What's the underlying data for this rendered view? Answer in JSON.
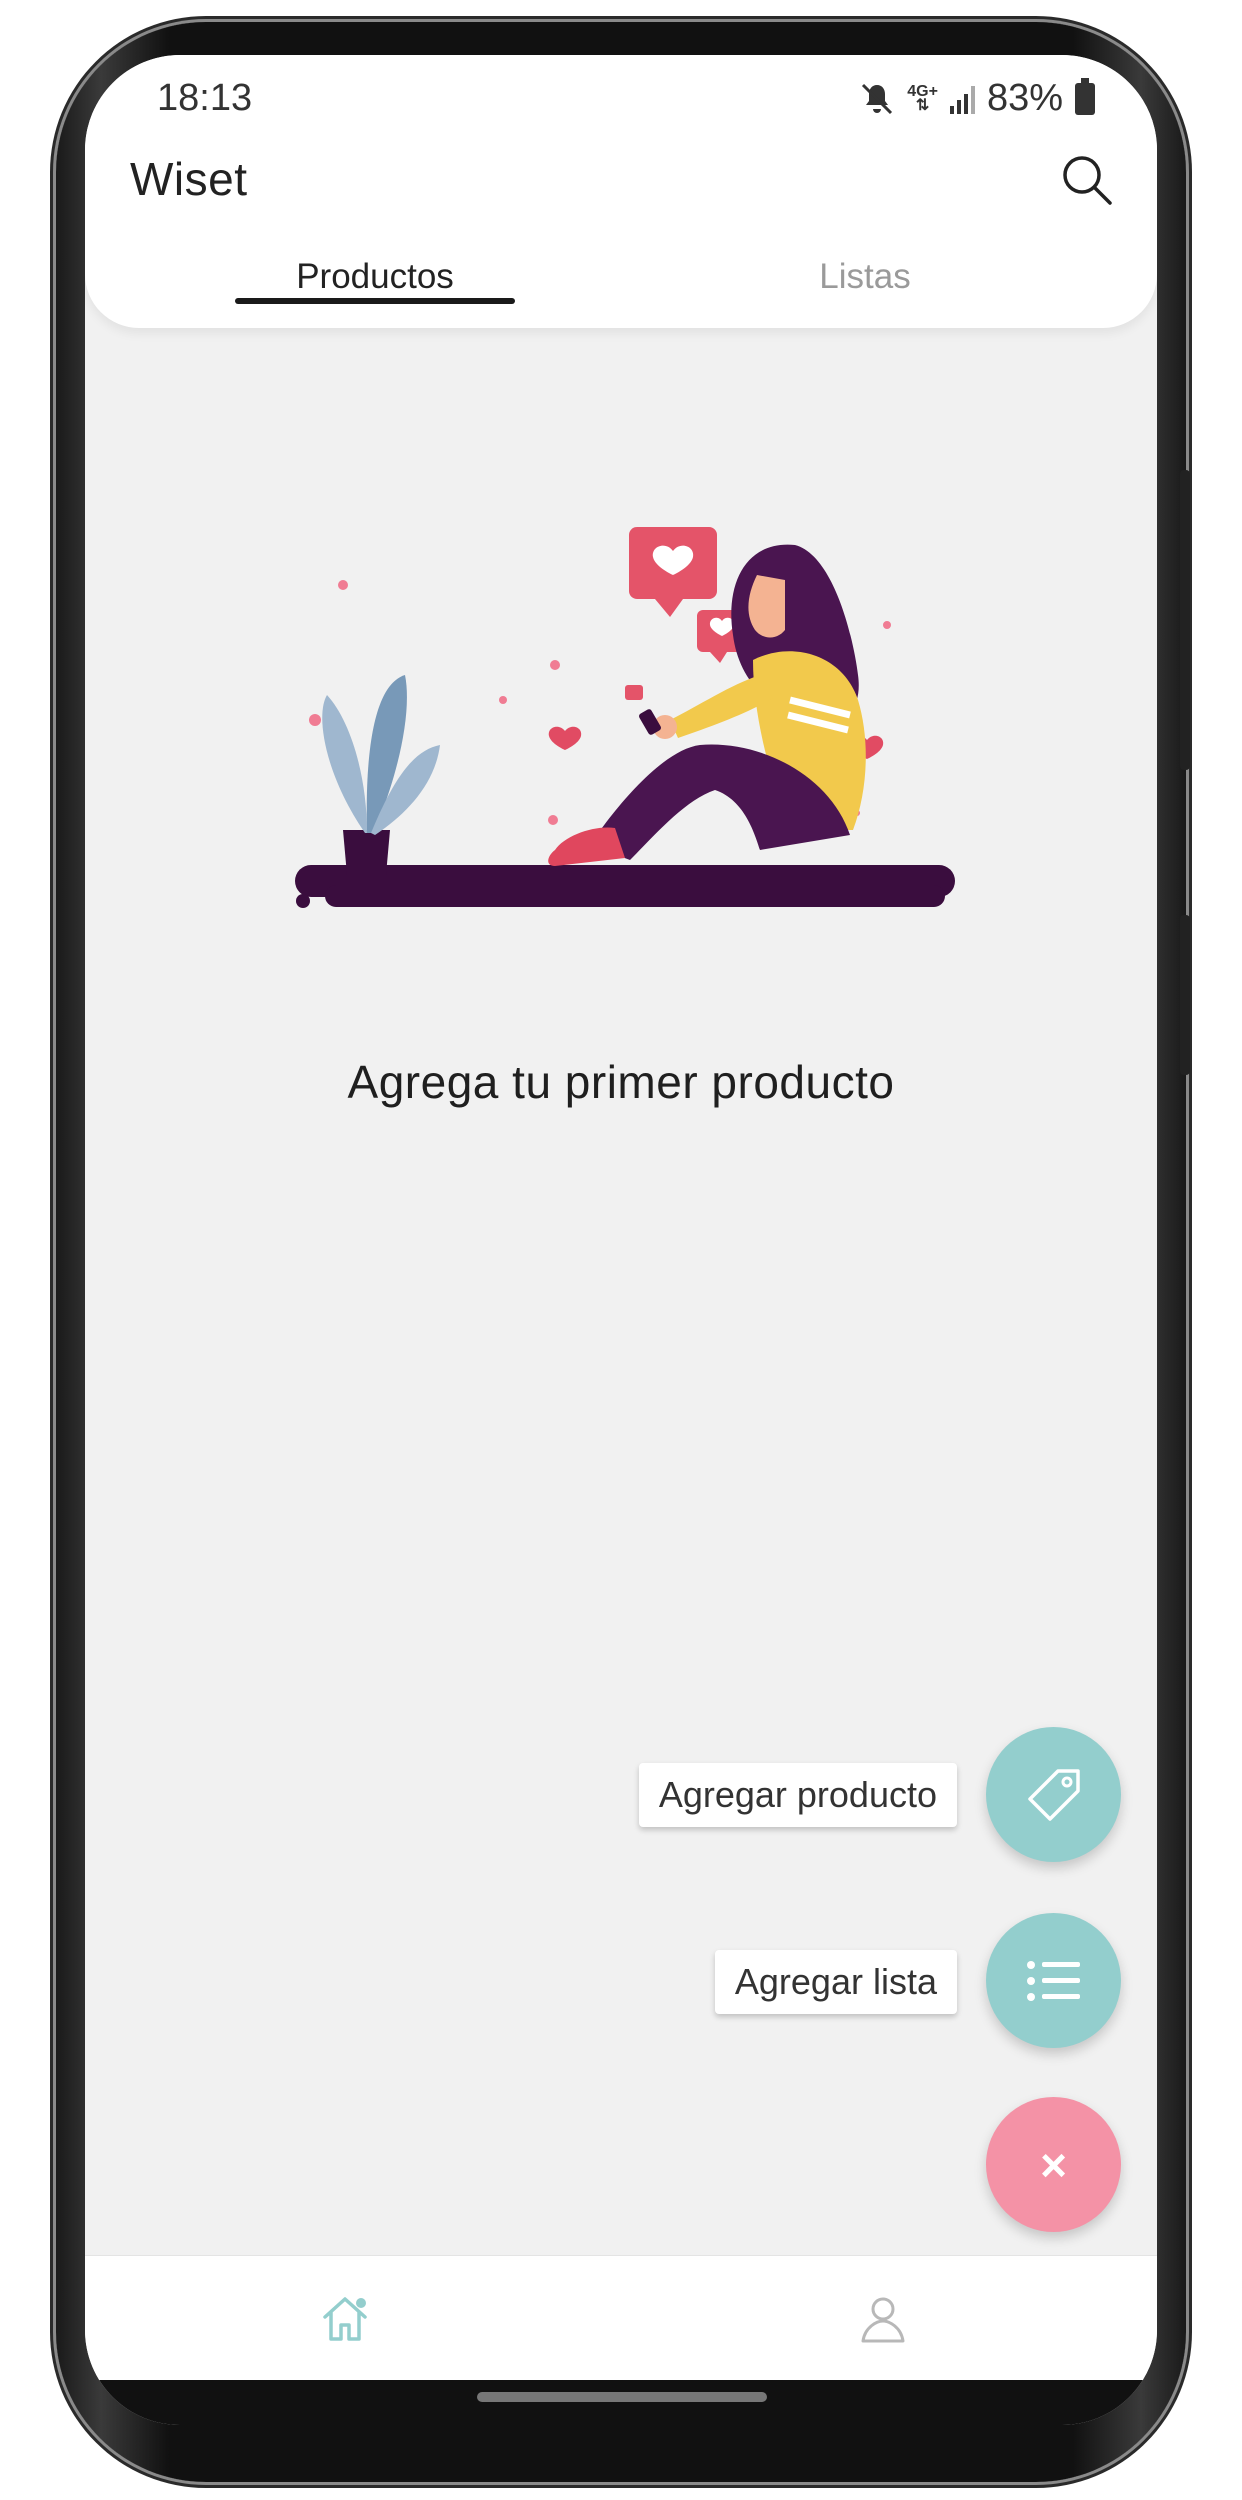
{
  "status_bar": {
    "time": "18:13",
    "network": "4G+",
    "battery": "83%",
    "icons": [
      "mute-icon",
      "signal-icon",
      "battery-icon"
    ]
  },
  "app_bar": {
    "title": "Wiset",
    "search_icon": "search-icon"
  },
  "tabs": [
    {
      "label": "Productos",
      "active": true
    },
    {
      "label": "Listas",
      "active": false
    }
  ],
  "main": {
    "empty_message": "Agrega tu primer producto"
  },
  "fab_menu": {
    "add_product_label": "Agregar producto",
    "add_product_icon": "tag-icon",
    "add_list_label": "Agregar lista",
    "add_list_icon": "list-icon",
    "close_label": "×"
  },
  "bottom_nav": {
    "items": [
      {
        "icon": "home-icon",
        "active": true
      },
      {
        "icon": "user-icon",
        "active": false
      }
    ]
  },
  "colors": {
    "accent_teal": "#93cecd",
    "accent_pink": "#f492a6",
    "background": "#f1f1f1"
  }
}
